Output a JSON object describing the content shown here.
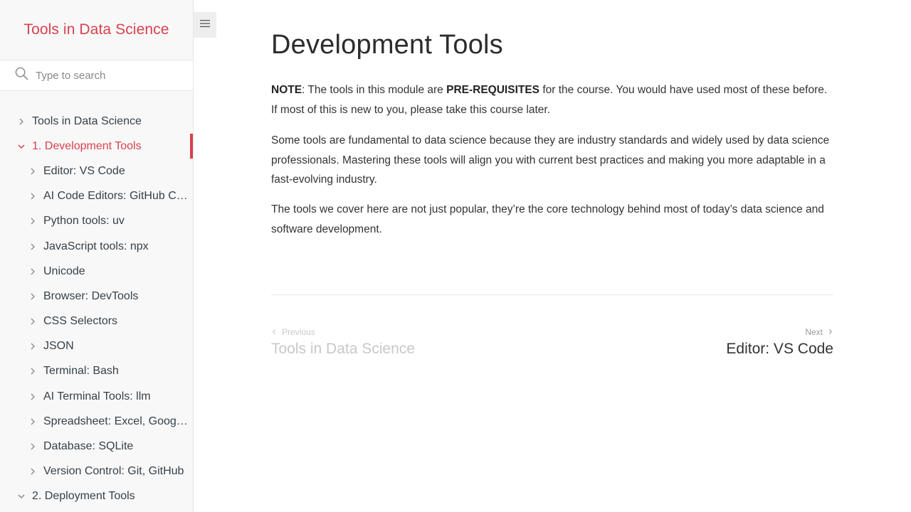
{
  "app": {
    "title": "Tools in Data Science"
  },
  "search": {
    "placeholder": "Type to search",
    "icon": "search-icon"
  },
  "menu_toggle": {
    "icon": "hamburger-icon"
  },
  "sidebar": {
    "accent_color": "#d9414e",
    "items": [
      {
        "label": "Tools in Data Science",
        "level": 0,
        "expanded": false,
        "active": false
      },
      {
        "label": "1. Development Tools",
        "level": 0,
        "expanded": true,
        "active": true
      },
      {
        "label": "Editor: VS Code",
        "level": 1,
        "expanded": false,
        "active": false
      },
      {
        "label": "AI Code Editors: GitHub Co...",
        "level": 1,
        "expanded": false,
        "active": false
      },
      {
        "label": "Python tools: uv",
        "level": 1,
        "expanded": false,
        "active": false
      },
      {
        "label": "JavaScript tools: npx",
        "level": 1,
        "expanded": false,
        "active": false
      },
      {
        "label": "Unicode",
        "level": 1,
        "expanded": false,
        "active": false
      },
      {
        "label": "Browser: DevTools",
        "level": 1,
        "expanded": false,
        "active": false
      },
      {
        "label": "CSS Selectors",
        "level": 1,
        "expanded": false,
        "active": false
      },
      {
        "label": "JSON",
        "level": 1,
        "expanded": false,
        "active": false
      },
      {
        "label": "Terminal: Bash",
        "level": 1,
        "expanded": false,
        "active": false
      },
      {
        "label": "AI Terminal Tools: llm",
        "level": 1,
        "expanded": false,
        "active": false
      },
      {
        "label": "Spreadsheet: Excel, Google ...",
        "level": 1,
        "expanded": false,
        "active": false
      },
      {
        "label": "Database: SQLite",
        "level": 1,
        "expanded": false,
        "active": false
      },
      {
        "label": "Version Control: Git, GitHub",
        "level": 1,
        "expanded": false,
        "active": false
      },
      {
        "label": "2. Deployment Tools",
        "level": 0,
        "expanded": true,
        "active": false
      }
    ]
  },
  "main": {
    "title": "Development Tools",
    "p1": {
      "note_label": "NOTE",
      "text_a": ": The tools in this module are ",
      "strong": "PRE-REQUISITES",
      "text_b": " for the course. You would have used most of these before. If most of this is new to you, please take this course later."
    },
    "p2": "Some tools are fundamental to data science because they are industry standards and widely used by data science professionals. Mastering these tools will align you with current best practices and making you more adaptable in a fast-evolving industry.",
    "p3": "The tools we cover here are not just popular, they’re the core technology behind most of today’s data science and software development."
  },
  "pager": {
    "prev_label": "Previous",
    "prev_title": "Tools in Data Science",
    "next_label": "Next",
    "next_title": "Editor: VS Code"
  }
}
